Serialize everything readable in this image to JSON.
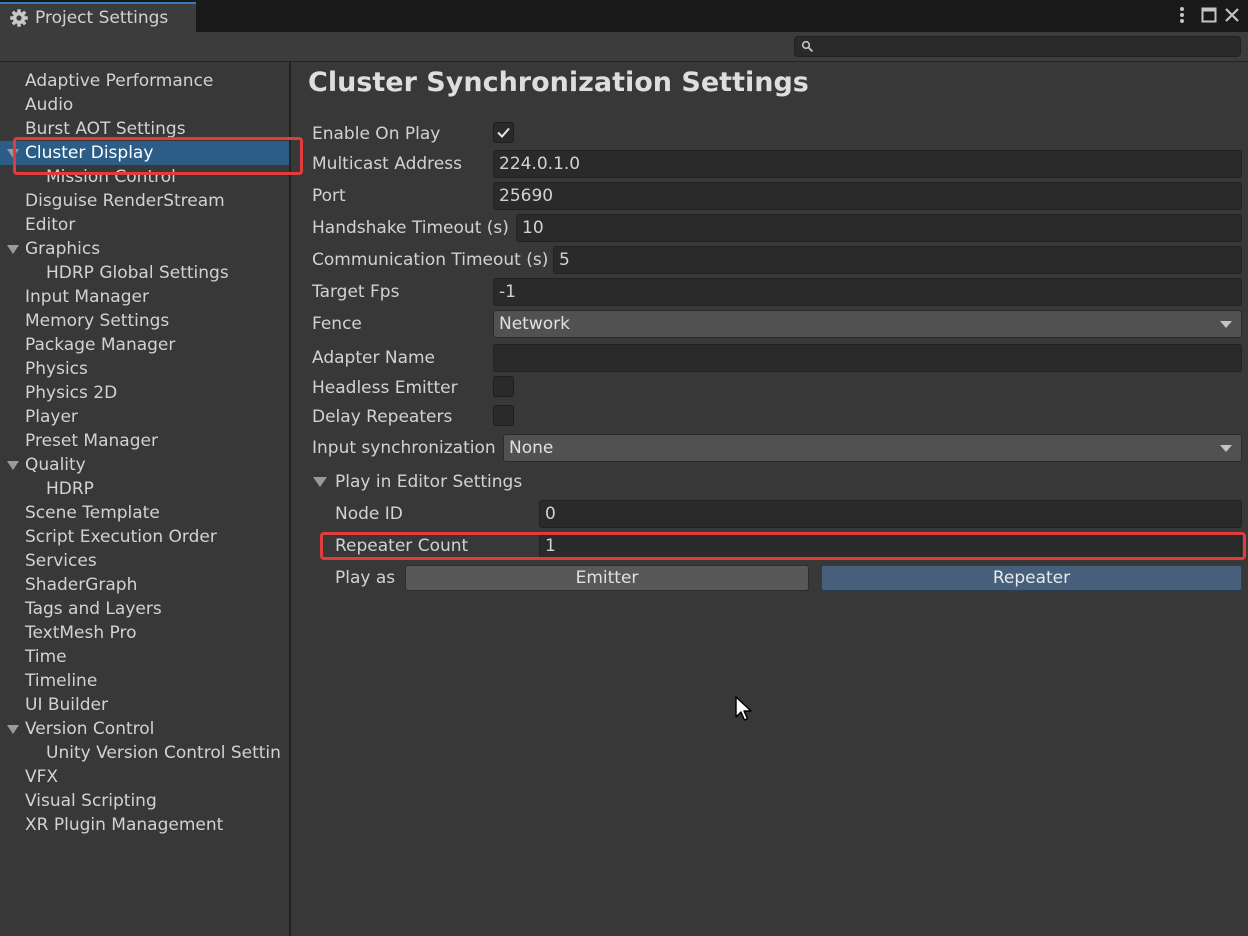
{
  "window": {
    "tab_title": "Project Settings",
    "tab_icon": "gear-icon",
    "menu_icon": "kebab-menu-icon",
    "maximize_icon": "maximize-icon",
    "close_icon": "close-icon"
  },
  "search": {
    "icon": "search-icon",
    "value": "",
    "placeholder": ""
  },
  "sidebar": {
    "items": [
      {
        "label": "Adaptive Performance",
        "indent": 0,
        "expandable": false,
        "selected": false
      },
      {
        "label": "Audio",
        "indent": 0,
        "expandable": false,
        "selected": false
      },
      {
        "label": "Burst AOT Settings",
        "indent": 0,
        "expandable": false,
        "selected": false
      },
      {
        "label": "Cluster Display",
        "indent": 0,
        "expandable": true,
        "selected": true
      },
      {
        "label": "Mission Control",
        "indent": 1,
        "expandable": false,
        "selected": false
      },
      {
        "label": "Disguise RenderStream",
        "indent": 0,
        "expandable": false,
        "selected": false
      },
      {
        "label": "Editor",
        "indent": 0,
        "expandable": false,
        "selected": false
      },
      {
        "label": "Graphics",
        "indent": 0,
        "expandable": true,
        "selected": false
      },
      {
        "label": "HDRP Global Settings",
        "indent": 1,
        "expandable": false,
        "selected": false
      },
      {
        "label": "Input Manager",
        "indent": 0,
        "expandable": false,
        "selected": false
      },
      {
        "label": "Memory Settings",
        "indent": 0,
        "expandable": false,
        "selected": false
      },
      {
        "label": "Package Manager",
        "indent": 0,
        "expandable": false,
        "selected": false
      },
      {
        "label": "Physics",
        "indent": 0,
        "expandable": false,
        "selected": false
      },
      {
        "label": "Physics 2D",
        "indent": 0,
        "expandable": false,
        "selected": false
      },
      {
        "label": "Player",
        "indent": 0,
        "expandable": false,
        "selected": false
      },
      {
        "label": "Preset Manager",
        "indent": 0,
        "expandable": false,
        "selected": false
      },
      {
        "label": "Quality",
        "indent": 0,
        "expandable": true,
        "selected": false
      },
      {
        "label": "HDRP",
        "indent": 1,
        "expandable": false,
        "selected": false
      },
      {
        "label": "Scene Template",
        "indent": 0,
        "expandable": false,
        "selected": false
      },
      {
        "label": "Script Execution Order",
        "indent": 0,
        "expandable": false,
        "selected": false
      },
      {
        "label": "Services",
        "indent": 0,
        "expandable": false,
        "selected": false
      },
      {
        "label": "ShaderGraph",
        "indent": 0,
        "expandable": false,
        "selected": false
      },
      {
        "label": "Tags and Layers",
        "indent": 0,
        "expandable": false,
        "selected": false
      },
      {
        "label": "TextMesh Pro",
        "indent": 0,
        "expandable": false,
        "selected": false
      },
      {
        "label": "Time",
        "indent": 0,
        "expandable": false,
        "selected": false
      },
      {
        "label": "Timeline",
        "indent": 0,
        "expandable": false,
        "selected": false
      },
      {
        "label": "UI Builder",
        "indent": 0,
        "expandable": false,
        "selected": false
      },
      {
        "label": "Version Control",
        "indent": 0,
        "expandable": true,
        "selected": false
      },
      {
        "label": "Unity Version Control Settin",
        "indent": 1,
        "expandable": false,
        "selected": false
      },
      {
        "label": "VFX",
        "indent": 0,
        "expandable": false,
        "selected": false
      },
      {
        "label": "Visual Scripting",
        "indent": 0,
        "expandable": false,
        "selected": false
      },
      {
        "label": "XR Plugin Management",
        "indent": 0,
        "expandable": false,
        "selected": false
      }
    ]
  },
  "settings": {
    "title": "Cluster Synchronization Settings",
    "enable_on_play": {
      "label": "Enable On Play",
      "checked": true
    },
    "multicast_address": {
      "label": "Multicast Address",
      "value": "224.0.1.0"
    },
    "port": {
      "label": "Port",
      "value": "25690"
    },
    "handshake_timeout": {
      "label": "Handshake Timeout (s)",
      "value": "10"
    },
    "communication_timeout": {
      "label": "Communication Timeout (s)",
      "value": "5"
    },
    "target_fps": {
      "label": "Target Fps",
      "value": "-1"
    },
    "fence": {
      "label": "Fence",
      "value": "Network"
    },
    "adapter_name": {
      "label": "Adapter Name",
      "value": ""
    },
    "headless_emitter": {
      "label": "Headless Emitter",
      "checked": false
    },
    "delay_repeaters": {
      "label": "Delay Repeaters",
      "checked": false
    },
    "input_sync": {
      "label": "Input synchronization",
      "value": "None"
    },
    "play_in_editor": {
      "label": "Play in Editor Settings",
      "expanded": true,
      "node_id": {
        "label": "Node ID",
        "value": "0"
      },
      "repeater_count": {
        "label": "Repeater Count",
        "value": "1"
      },
      "play_as": {
        "label": "Play as",
        "emitter": "Emitter",
        "repeater": "Repeater",
        "selected": "Repeater"
      }
    }
  },
  "colors": {
    "background": "#383838",
    "selection": "#2c5d87",
    "highlight": "#e03c3c",
    "repeater_button": "#46607c"
  }
}
